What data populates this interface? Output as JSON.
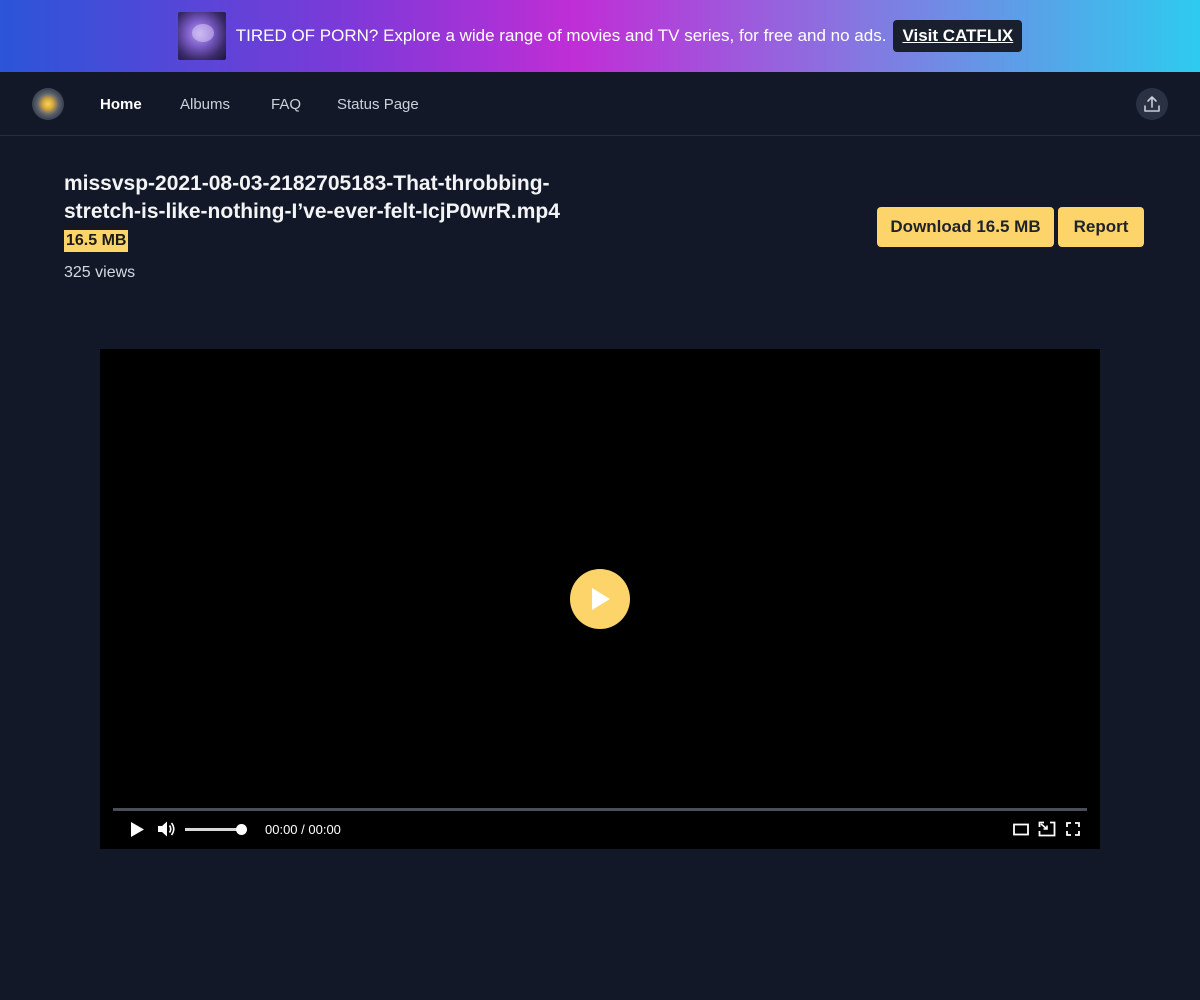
{
  "banner": {
    "text": "TIRED OF PORN? Explore a wide range of movies and TV series, for free and no ads.",
    "button_label": "Visit CATFLIX"
  },
  "nav": {
    "links": [
      {
        "label": "Home",
        "active": true
      },
      {
        "label": "Albums",
        "active": false
      },
      {
        "label": "FAQ",
        "active": false
      },
      {
        "label": "Status Page",
        "active": false
      }
    ]
  },
  "file": {
    "title": "missvsp-2021-08-03-2182705183-That-throbbing-stretch-is-like-nothing-I’ve-ever-felt-IcjP0wrR.mp4",
    "size": "16.5 MB",
    "views": "325 views"
  },
  "actions": {
    "download_label": "Download 16.5 MB",
    "report_label": "Report"
  },
  "player": {
    "time": "00:00 / 00:00",
    "progress": 0,
    "volume": 1.0
  },
  "colors": {
    "background": "#121827",
    "accent": "#fcd46a",
    "player_background": "#000000"
  }
}
